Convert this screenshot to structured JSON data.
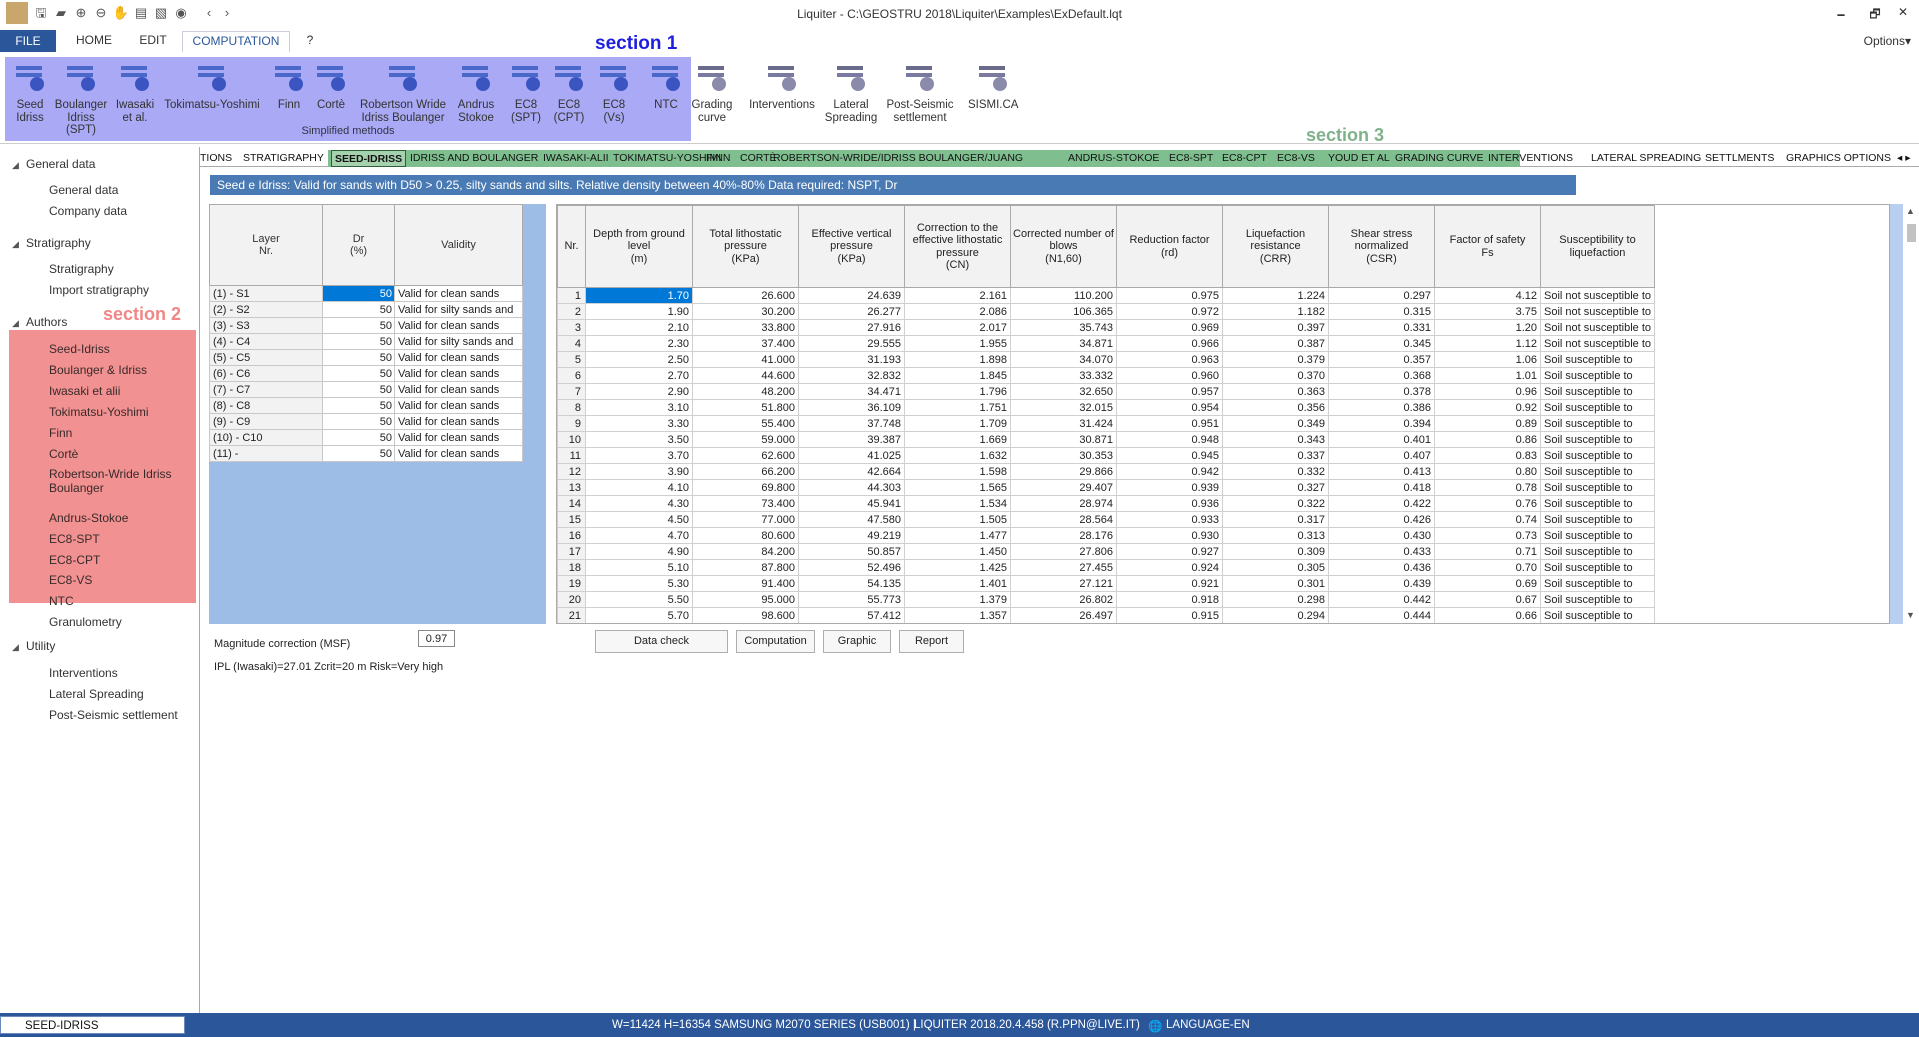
{
  "window": {
    "title": "Liquiter - C:\\GEOSTRU 2018\\Liquiter\\Examples\\ExDefault.lqt",
    "minimize": "🗕",
    "maximize": "🗗",
    "close": "✕"
  },
  "menu_tabs": {
    "file": "FILE",
    "home": "HOME",
    "edit": "EDIT",
    "computation": "COMPUTATION",
    "help": "?",
    "options": "Options▾"
  },
  "ribbon": {
    "section_label": "section 1",
    "group_label": "Simplified methods",
    "buttons": [
      {
        "label1": "Seed",
        "label2": "Idriss",
        "icon": "DR"
      },
      {
        "label1": "Boulanger",
        "label2": "Idriss (SPT)",
        "icon": "NSPT"
      },
      {
        "label1": "Iwasaki",
        "label2": "et al.",
        "icon": ""
      },
      {
        "label1": "Tokimatsu-Yoshimi",
        "label2": "",
        "icon": "C"
      },
      {
        "label1": "Finn",
        "label2": "",
        "icon": ""
      },
      {
        "label1": "Cortè",
        "label2": "",
        "icon": "D50"
      },
      {
        "label1": "Robertson Wride",
        "label2": "Idriss Boulanger",
        "icon": ""
      },
      {
        "label1": "Andrus",
        "label2": "Stokoe",
        "icon": ""
      },
      {
        "label1": "EC8",
        "label2": "(SPT)",
        "icon": "IP"
      },
      {
        "label1": "EC8",
        "label2": "(CPT)",
        "icon": "IP"
      },
      {
        "label1": "EC8",
        "label2": "(Vs)",
        "icon": ""
      },
      {
        "label1": "NTC",
        "label2": "",
        "icon": "IP"
      },
      {
        "label1": "Grading",
        "label2": "curve",
        "icon": ""
      },
      {
        "label1": "Interventions",
        "label2": "",
        "icon": ""
      },
      {
        "label1": "Lateral",
        "label2": "Spreading",
        "icon": ""
      },
      {
        "label1": "Post-Seismic",
        "label2": "settlement",
        "icon": ""
      },
      {
        "label1": "SISMI.CA",
        "label2": "",
        "icon": ""
      }
    ]
  },
  "left_panel": {
    "section_label": "section 2",
    "groups": {
      "general": "General data",
      "stratigraphy": "Stratigraphy",
      "authors": "Authors",
      "utility": "Utility"
    },
    "general_items": [
      "General data",
      "Company data"
    ],
    "strat_items": [
      "Stratigraphy",
      "Import stratigraphy"
    ],
    "author_items": [
      "Seed-Idriss",
      "Boulanger & Idriss",
      "Iwasaki et alii",
      "Tokimatsu-Yoshimi",
      "Finn",
      "Cortè",
      "Robertson-Wride Idriss Boulanger",
      "Andrus-Stokoe",
      "EC8-SPT",
      "EC8-CPT",
      "EC8-VS",
      "NTC"
    ],
    "granulometry": "Granulometry",
    "utility_items": [
      "Interventions",
      "Lateral Spreading",
      "Post-Seismic settlement"
    ]
  },
  "subtabs": {
    "section_label": "section 3",
    "items": [
      "TIONS",
      "STRATIGRAPHY",
      "SEED-IDRISS",
      "IDRISS AND BOULANGER",
      "IWASAKI-ALII",
      "TOKIMATSU-YOSHIMI",
      "FINN",
      "CORTÈ",
      "ROBERTSON-WRIDE/IDRISS BOULANGER/JUANG",
      "ANDRUS-STOKOE",
      "EC8-SPT",
      "EC8-CPT",
      "EC8-VS",
      "YOUD ET AL",
      "GRADING CURVE",
      "INTERVENTIONS",
      "LATERAL SPREADING",
      "SETTLMENTS",
      "GRAPHICS OPTIONS"
    ],
    "nav": "◂ ▸"
  },
  "description": "Seed e Idriss: Valid for sands with D50 > 0.25, silty sands and silts. Relative density between 40%-80% Data required: NSPT, Dr",
  "layer_table": {
    "headers": {
      "layer": "Layer\nNr.",
      "dr": "Dr\n(%)",
      "validity": "Validity"
    },
    "rows": [
      [
        "(1) - S1",
        "50",
        "Valid for clean sands"
      ],
      [
        "(2) - S2",
        "50",
        "Valid for silty sands and"
      ],
      [
        "(3) - S3",
        "50",
        "Valid for clean sands"
      ],
      [
        "(4) - C4",
        "50",
        "Valid for silty sands and"
      ],
      [
        "(5) - C5",
        "50",
        "Valid for clean sands"
      ],
      [
        "(6) - C6",
        "50",
        "Valid for clean sands"
      ],
      [
        "(7) - C7",
        "50",
        "Valid for clean sands"
      ],
      [
        "(8) - C8",
        "50",
        "Valid for clean sands"
      ],
      [
        "(9) - C9",
        "50",
        "Valid for clean sands"
      ],
      [
        "(10) - C10",
        "50",
        "Valid for clean sands"
      ],
      [
        "(11) -",
        "50",
        "Valid for clean sands"
      ]
    ]
  },
  "result_table": {
    "headers": [
      "Nr.",
      "Depth from ground level\n(m)",
      "Total lithostatic pressure\n(KPa)",
      "Effective vertical\npressure\n(KPa)",
      "Correction to the\neffective lithostatic\npressure\n(CN)",
      "Corrected number of\nblows\n(N1,60)",
      "Reduction factor\n(rd)",
      "Liquefaction resistance\n(CRR)",
      "Shear stress normalized\n(CSR)",
      "Factor of safety\nFs",
      "Susceptibility to\nliquefaction"
    ],
    "rows": [
      [
        "1",
        "1.70",
        "26.600",
        "24.639",
        "2.161",
        "110.200",
        "0.975",
        "1.224",
        "0.297",
        "4.12",
        "Soil not susceptible to"
      ],
      [
        "2",
        "1.90",
        "30.200",
        "26.277",
        "2.086",
        "106.365",
        "0.972",
        "1.182",
        "0.315",
        "3.75",
        "Soil not susceptible to"
      ],
      [
        "3",
        "2.10",
        "33.800",
        "27.916",
        "2.017",
        "35.743",
        "0.969",
        "0.397",
        "0.331",
        "1.20",
        "Soil not susceptible to"
      ],
      [
        "4",
        "2.30",
        "37.400",
        "29.555",
        "1.955",
        "34.871",
        "0.966",
        "0.387",
        "0.345",
        "1.12",
        "Soil not susceptible to"
      ],
      [
        "5",
        "2.50",
        "41.000",
        "31.193",
        "1.898",
        "34.070",
        "0.963",
        "0.379",
        "0.357",
        "1.06",
        "Soil susceptible to"
      ],
      [
        "6",
        "2.70",
        "44.600",
        "32.832",
        "1.845",
        "33.332",
        "0.960",
        "0.370",
        "0.368",
        "1.01",
        "Soil susceptible to"
      ],
      [
        "7",
        "2.90",
        "48.200",
        "34.471",
        "1.796",
        "32.650",
        "0.957",
        "0.363",
        "0.378",
        "0.96",
        "Soil susceptible to"
      ],
      [
        "8",
        "3.10",
        "51.800",
        "36.109",
        "1.751",
        "32.015",
        "0.954",
        "0.356",
        "0.386",
        "0.92",
        "Soil susceptible to"
      ],
      [
        "9",
        "3.30",
        "55.400",
        "37.748",
        "1.709",
        "31.424",
        "0.951",
        "0.349",
        "0.394",
        "0.89",
        "Soil susceptible to"
      ],
      [
        "10",
        "3.50",
        "59.000",
        "39.387",
        "1.669",
        "30.871",
        "0.948",
        "0.343",
        "0.401",
        "0.86",
        "Soil susceptible to"
      ],
      [
        "11",
        "3.70",
        "62.600",
        "41.025",
        "1.632",
        "30.353",
        "0.945",
        "0.337",
        "0.407",
        "0.83",
        "Soil susceptible to"
      ],
      [
        "12",
        "3.90",
        "66.200",
        "42.664",
        "1.598",
        "29.866",
        "0.942",
        "0.332",
        "0.413",
        "0.80",
        "Soil susceptible to"
      ],
      [
        "13",
        "4.10",
        "69.800",
        "44.303",
        "1.565",
        "29.407",
        "0.939",
        "0.327",
        "0.418",
        "0.78",
        "Soil susceptible to"
      ],
      [
        "14",
        "4.30",
        "73.400",
        "45.941",
        "1.534",
        "28.974",
        "0.936",
        "0.322",
        "0.422",
        "0.76",
        "Soil susceptible to"
      ],
      [
        "15",
        "4.50",
        "77.000",
        "47.580",
        "1.505",
        "28.564",
        "0.933",
        "0.317",
        "0.426",
        "0.74",
        "Soil susceptible to"
      ],
      [
        "16",
        "4.70",
        "80.600",
        "49.219",
        "1.477",
        "28.176",
        "0.930",
        "0.313",
        "0.430",
        "0.73",
        "Soil susceptible to"
      ],
      [
        "17",
        "4.90",
        "84.200",
        "50.857",
        "1.450",
        "27.806",
        "0.927",
        "0.309",
        "0.433",
        "0.71",
        "Soil susceptible to"
      ],
      [
        "18",
        "5.10",
        "87.800",
        "52.496",
        "1.425",
        "27.455",
        "0.924",
        "0.305",
        "0.436",
        "0.70",
        "Soil susceptible to"
      ],
      [
        "19",
        "5.30",
        "91.400",
        "54.135",
        "1.401",
        "27.121",
        "0.921",
        "0.301",
        "0.439",
        "0.69",
        "Soil susceptible to"
      ],
      [
        "20",
        "5.50",
        "95.000",
        "55.773",
        "1.379",
        "26.802",
        "0.918",
        "0.298",
        "0.442",
        "0.67",
        "Soil susceptible to"
      ],
      [
        "21",
        "5.70",
        "98.600",
        "57.412",
        "1.357",
        "26.497",
        "0.915",
        "0.294",
        "0.444",
        "0.66",
        "Soil susceptible to"
      ]
    ]
  },
  "bottom": {
    "msf_label": "Magnitude correction (MSF)",
    "msf_value": "0.97",
    "ipl": "IPL (Iwasaki)=27.01 Zcrit=20 m Risk=Very high",
    "buttons": [
      "Data check",
      "Computation",
      "Graphic",
      "Report"
    ]
  },
  "status": {
    "left": "SEED-IDRISS",
    "printer": "W=11424 H=16354 SAMSUNG M2070 SERIES (USB001) |",
    "version": "LIQUITER 2018.20.4.458 (R.PPN@LIVE.IT)",
    "language_icon": "🌐",
    "language": "LANGUAGE-EN"
  },
  "colors": {
    "accent": "#2b579a",
    "section1": "#a9a9f5",
    "section2": "#f19191",
    "section3": "#7fbf8f",
    "selection": "#0078d7"
  }
}
